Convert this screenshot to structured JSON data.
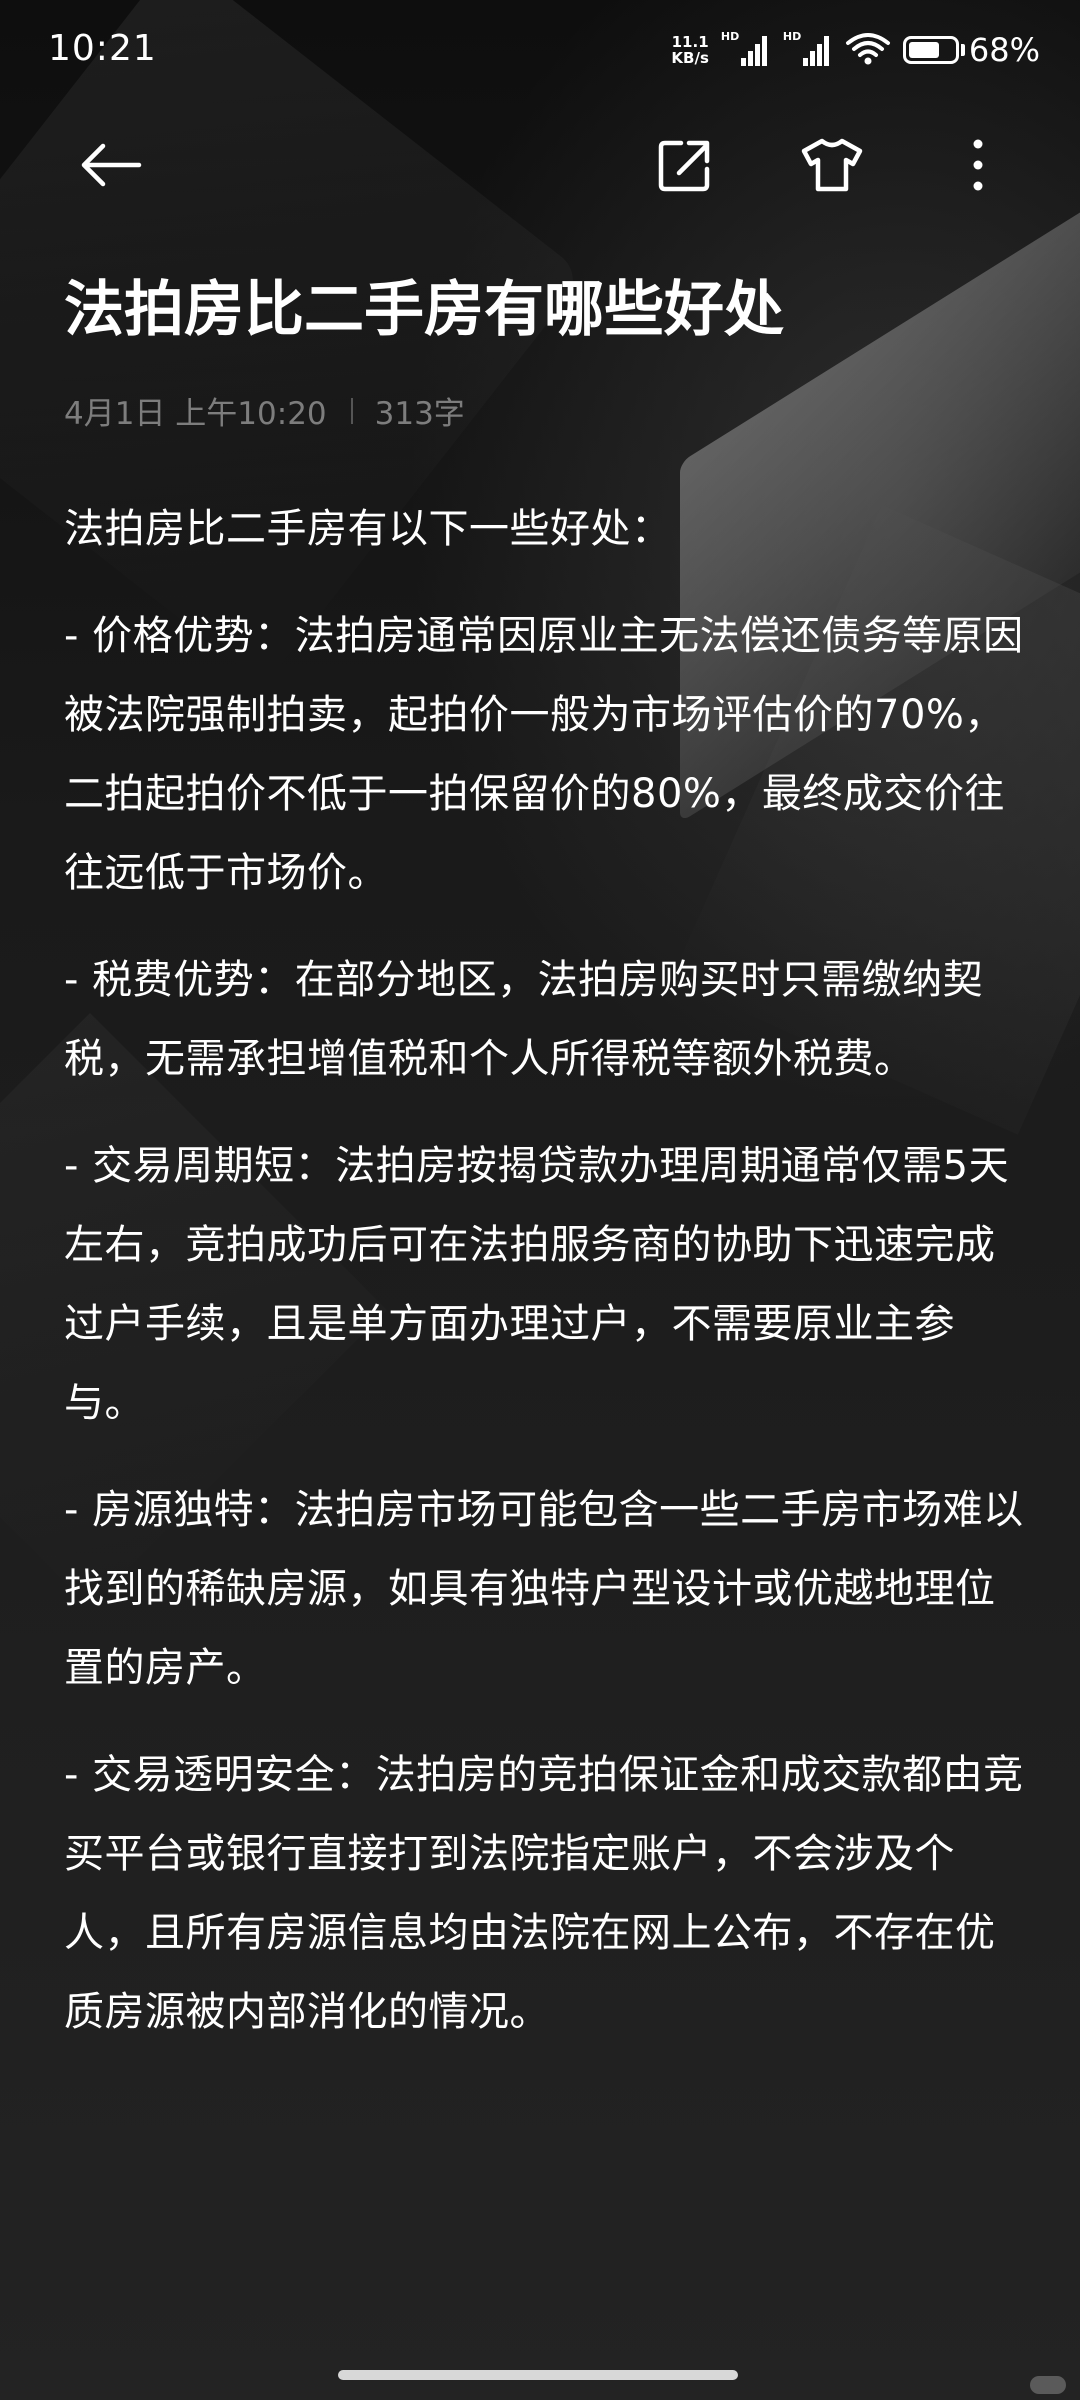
{
  "status_bar": {
    "time": "10:21",
    "net_speed_value": "11.1",
    "net_speed_unit": "KB/s",
    "signal_badge": "HD",
    "battery_percent": "68%",
    "battery_level": 0.68,
    "icons": [
      "signal-hd-icon",
      "signal-hd-icon",
      "wifi-icon",
      "battery-icon"
    ]
  },
  "toolbar": {
    "back_icon": "arrow-left-icon",
    "share_icon": "share-icon",
    "theme_icon": "tshirt-icon",
    "more_icon": "more-vertical-icon"
  },
  "note": {
    "title": "法拍房比二手房有哪些好处",
    "date": "4月1日 上午10:20",
    "word_count": "313字",
    "intro": "法拍房比二手房有以下一些好处：",
    "paragraphs": [
      "- 价格优势：法拍房通常因原业主无法偿还债务等原因被法院强制拍卖，起拍价一般为市场评估价的70%，二拍起拍价不低于一拍保留价的80%，最终成交价往往远低于市场价。",
      "- 税费优势：在部分地区，法拍房购买时只需缴纳契税，无需承担增值税和个人所得税等额外税费。",
      "- 交易周期短：法拍房按揭贷款办理周期通常仅需5天左右，竞拍成功后可在法拍服务商的协助下迅速完成过户手续，且是单方面办理过户，不需要原业主参与。",
      "- 房源独特：法拍房市场可能包含一些二手房市场难以找到的稀缺房源，如具有独特户型设计或优越地理位置的房产。",
      "- 交易透明安全：法拍房的竞拍保证金和成交款都由竞买平台或银行直接打到法院指定账户，不会涉及个人，且所有房源信息均由法院在网上公布，不存在优质房源被内部消化的情况。"
    ]
  },
  "colors": {
    "background": "#1c1c1c",
    "text": "#ffffff",
    "meta_text": "#7d7d7d"
  }
}
